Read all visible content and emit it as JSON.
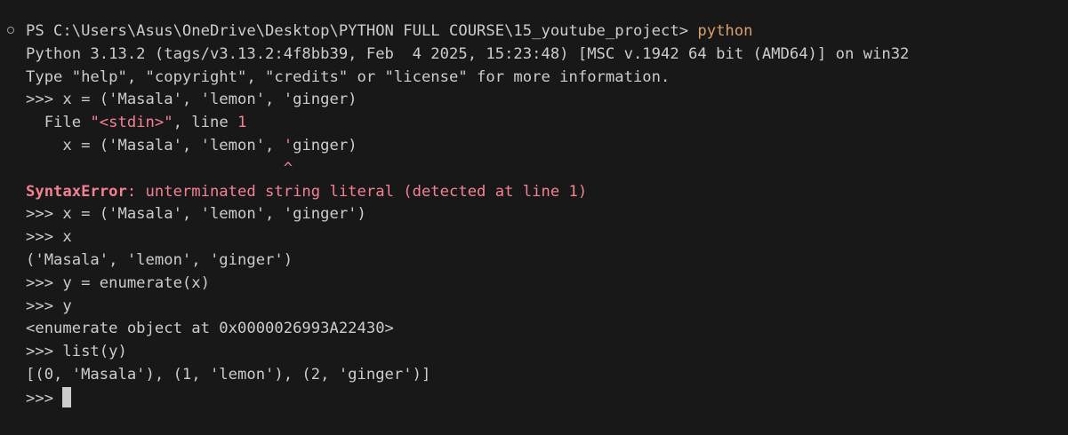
{
  "terminal": {
    "prompt": "PS C:\\Users\\Asus\\OneDrive\\Desktop\\PYTHON FULL COURSE\\15_youtube_project> ",
    "command": "python",
    "banner_line1": "Python 3.13.2 (tags/v3.13.2:4f8bb39, Feb  4 2025, 15:23:48) [MSC v.1942 64 bit (AMD64)] on win32",
    "banner_line2": "Type \"help\", \"copyright\", \"credits\" or \"license\" for more information.",
    "repl": {
      "input1": ">>> x = ('Masala', 'lemon', 'ginger)",
      "trace_file_prefix": "  File ",
      "trace_file_name": "\"<stdin>\"",
      "trace_line_prefix": ", line ",
      "trace_line_num": "1",
      "trace_code_before": "    x = ('Masala', 'lemon', ",
      "trace_code_error": "'",
      "trace_code_after": "ginger)",
      "trace_caret": "                            ^",
      "error_name": "SyntaxError",
      "error_message": ": unterminated string literal (detected at line 1)",
      "input2": ">>> x = ('Masala', 'lemon', 'ginger')",
      "input3": ">>> x",
      "output3": "('Masala', 'lemon', 'ginger')",
      "input4": ">>> y = enumerate(x)",
      "input5": ">>> y",
      "output5": "<enumerate object at 0x0000026993A22430>",
      "input6": ">>> list(y)",
      "output6": "[(0, 'Masala'), (1, 'lemon'), (2, 'ginger')]",
      "current_prompt": ">>> "
    }
  },
  "colors": {
    "background": "#181818",
    "text": "#cccccc",
    "command": "#d7a06a",
    "error": "#f48193"
  }
}
